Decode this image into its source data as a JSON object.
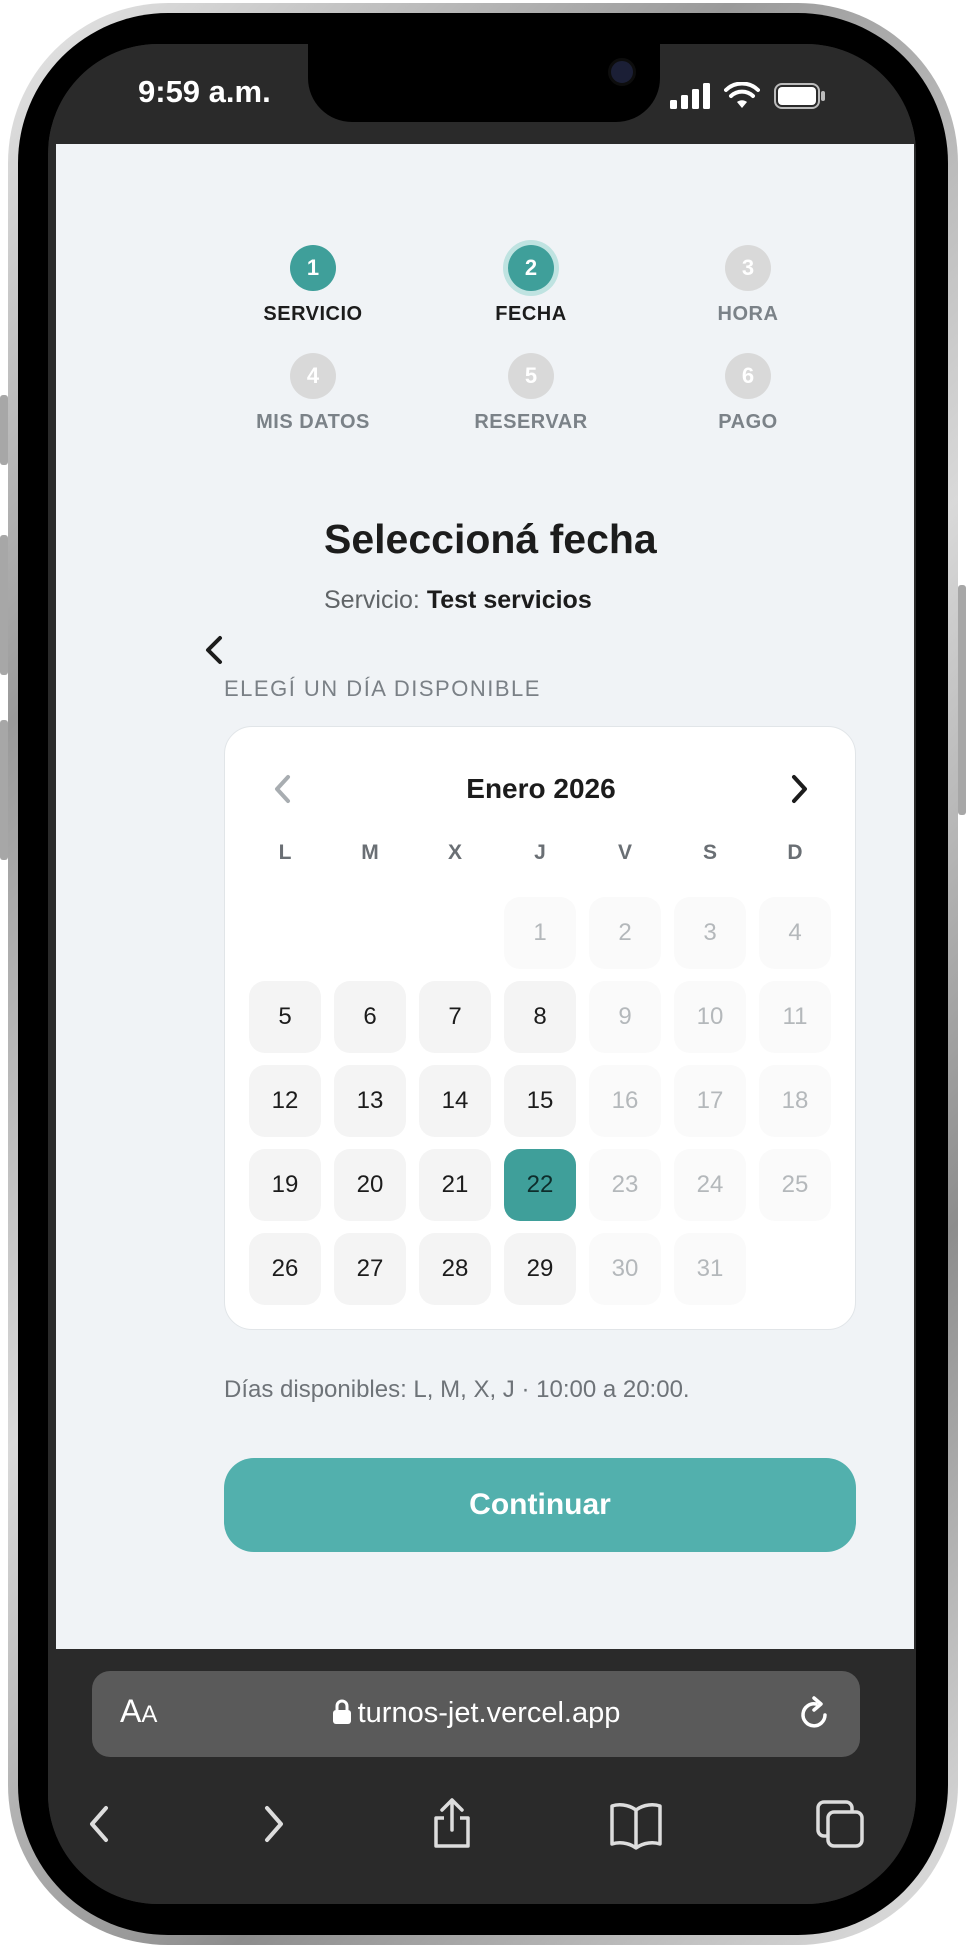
{
  "status_bar": {
    "time": "9:59 a.m."
  },
  "stepper": [
    {
      "number": "1",
      "label": "SERVICIO",
      "state": "done"
    },
    {
      "number": "2",
      "label": "FECHA",
      "state": "current"
    },
    {
      "number": "3",
      "label": "HORA",
      "state": "pending"
    },
    {
      "number": "4",
      "label": "MIS DATOS",
      "state": "pending"
    },
    {
      "number": "5",
      "label": "RESERVAR",
      "state": "pending"
    },
    {
      "number": "6",
      "label": "PAGO",
      "state": "pending"
    }
  ],
  "header": {
    "title": "Seleccioná fecha",
    "subtitle_prefix": "Servicio:",
    "service_name": "Test servicios"
  },
  "calendar": {
    "section_label": "ELEGÍ UN DÍA DISPONIBLE",
    "month_label": "Enero 2026",
    "weekdays": [
      "L",
      "M",
      "X",
      "J",
      "V",
      "S",
      "D"
    ],
    "leading_blanks": 3,
    "days": [
      {
        "n": "1",
        "state": "disabled"
      },
      {
        "n": "2",
        "state": "disabled"
      },
      {
        "n": "3",
        "state": "disabled"
      },
      {
        "n": "4",
        "state": "disabled"
      },
      {
        "n": "5",
        "state": "available"
      },
      {
        "n": "6",
        "state": "available"
      },
      {
        "n": "7",
        "state": "available"
      },
      {
        "n": "8",
        "state": "available"
      },
      {
        "n": "9",
        "state": "disabled"
      },
      {
        "n": "10",
        "state": "disabled"
      },
      {
        "n": "11",
        "state": "disabled"
      },
      {
        "n": "12",
        "state": "available"
      },
      {
        "n": "13",
        "state": "available"
      },
      {
        "n": "14",
        "state": "available"
      },
      {
        "n": "15",
        "state": "available"
      },
      {
        "n": "16",
        "state": "disabled"
      },
      {
        "n": "17",
        "state": "disabled"
      },
      {
        "n": "18",
        "state": "disabled"
      },
      {
        "n": "19",
        "state": "available"
      },
      {
        "n": "20",
        "state": "available"
      },
      {
        "n": "21",
        "state": "available"
      },
      {
        "n": "22",
        "state": "selected"
      },
      {
        "n": "23",
        "state": "disabled"
      },
      {
        "n": "24",
        "state": "disabled"
      },
      {
        "n": "25",
        "state": "disabled"
      },
      {
        "n": "26",
        "state": "available"
      },
      {
        "n": "27",
        "state": "available"
      },
      {
        "n": "28",
        "state": "available"
      },
      {
        "n": "29",
        "state": "available"
      },
      {
        "n": "30",
        "state": "disabled"
      },
      {
        "n": "31",
        "state": "disabled"
      }
    ]
  },
  "availability_note": "Días disponibles: L, M, X, J · 10:00 a 20:00.",
  "continue_label": "Continuar",
  "browser": {
    "aa_label_big": "A",
    "aa_label_small": "A",
    "url": "turnos-jet.vercel.app"
  },
  "colors": {
    "accent": "#3f9f9a",
    "button": "#52b0ad",
    "background": "#f0f3f6"
  },
  "icons": {
    "back": "chevron-left-icon",
    "prev_month": "chevron-left-icon",
    "next_month": "chevron-right-icon",
    "lock": "lock-icon",
    "reload": "reload-icon",
    "share": "share-icon",
    "bookmarks": "book-icon",
    "tabs": "tabs-icon"
  }
}
